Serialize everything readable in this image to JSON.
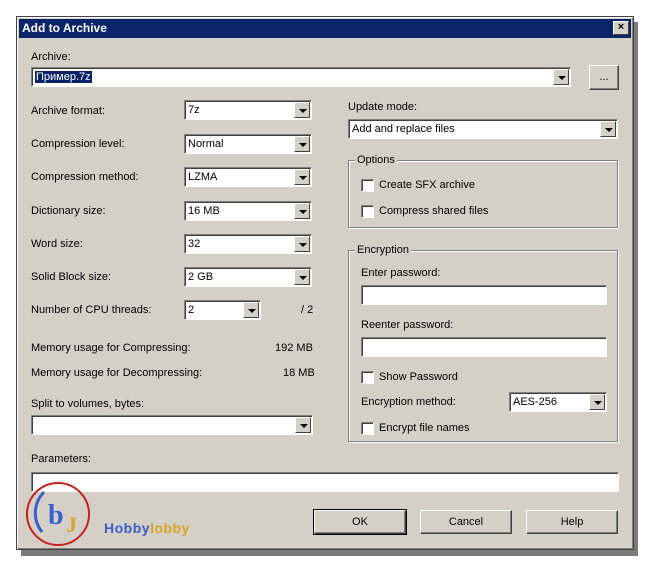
{
  "window": {
    "title": "Add to Archive",
    "close_glyph": "×"
  },
  "archive": {
    "label": "Archive:",
    "value": "Пример.7z",
    "browse_label": "..."
  },
  "left": {
    "archive_format": {
      "label": "Archive format:",
      "value": "7z"
    },
    "compression_level": {
      "label": "Compression level:",
      "value": "Normal"
    },
    "compression_method": {
      "label": "Compression method:",
      "value": "LZMA"
    },
    "dictionary_size": {
      "label": "Dictionary size:",
      "value": "16 MB"
    },
    "word_size": {
      "label": "Word size:",
      "value": "32"
    },
    "solid_block_size": {
      "label": "Solid Block size:",
      "value": "2 GB"
    },
    "cpu_threads": {
      "label": "Number of CPU threads:",
      "value": "2",
      "max": "/ 2"
    },
    "memory_compress": {
      "label": "Memory usage for Compressing:",
      "value": "192 MB"
    },
    "memory_decompress": {
      "label": "Memory usage for Decompressing:",
      "value": "18 MB"
    },
    "split": {
      "label": "Split to volumes, bytes:",
      "value": ""
    }
  },
  "right": {
    "update_mode": {
      "label": "Update mode:",
      "value": "Add and replace files"
    },
    "options": {
      "legend": "Options",
      "create_sfx": "Create SFX archive",
      "compress_shared": "Compress shared files"
    },
    "encryption": {
      "legend": "Encryption",
      "enter_password": "Enter password:",
      "reenter_password": "Reenter password:",
      "show_password": "Show Password",
      "method_label": "Encryption method:",
      "method_value": "AES-256",
      "encrypt_names": "Encrypt file names"
    }
  },
  "parameters": {
    "label": "Parameters:",
    "value": ""
  },
  "buttons": {
    "ok": "OK",
    "cancel": "Cancel",
    "help": "Help"
  },
  "watermark": {
    "text_a": "Hobby",
    "text_b": "lobby",
    "colors": {
      "blue": "#3a5fcd",
      "red": "#c81e1e",
      "gold": "#d9a520"
    }
  }
}
